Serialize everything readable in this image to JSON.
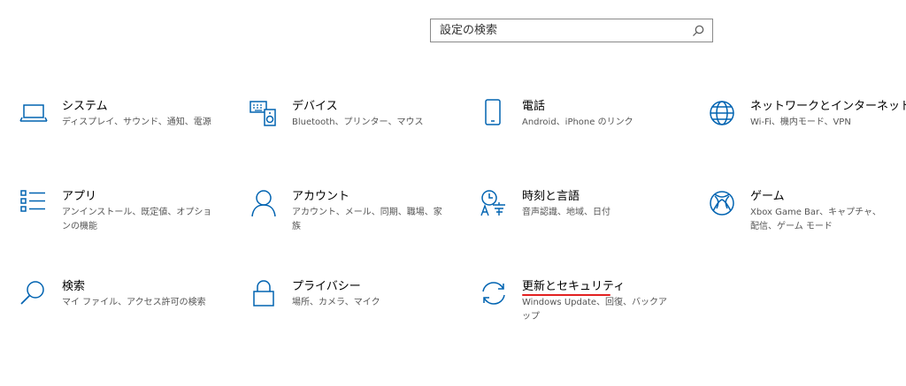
{
  "search": {
    "placeholder": "設定の検索",
    "icon": "search-icon"
  },
  "accent": "#0063b1",
  "tiles": [
    {
      "title": "システム",
      "desc": "ディスプレイ、サウンド、通知、電源",
      "icon": "laptop-icon"
    },
    {
      "title": "デバイス",
      "desc": "Bluetooth、プリンター、マウス",
      "icon": "keyboard-speaker-icon"
    },
    {
      "title": "電話",
      "desc": "Android、iPhone のリンク",
      "icon": "phone-icon"
    },
    {
      "title": "ネットワークとインターネット",
      "desc": "Wi-Fi、機内モード、VPN",
      "icon": "globe-icon"
    },
    {
      "title": "アプリ",
      "desc": "アンインストール、既定値、オプションの機能",
      "icon": "apps-list-icon"
    },
    {
      "title": "アカウント",
      "desc": "アカウント、メール、同期、職場、家族",
      "icon": "person-icon"
    },
    {
      "title": "時刻と言語",
      "desc": "音声認識、地域、日付",
      "icon": "time-language-icon"
    },
    {
      "title": "ゲーム",
      "desc": "Xbox Game Bar、キャプチャ、配信、ゲーム モード",
      "icon": "xbox-icon"
    },
    {
      "title": "検索",
      "desc": "マイ ファイル、アクセス許可の検索",
      "icon": "search-icon"
    },
    {
      "title": "プライバシー",
      "desc": "場所、カメラ、マイク",
      "icon": "lock-icon"
    },
    {
      "title": "更新とセキュリティ",
      "desc": "Windows Update、回復、バックアップ",
      "icon": "update-icon"
    }
  ]
}
